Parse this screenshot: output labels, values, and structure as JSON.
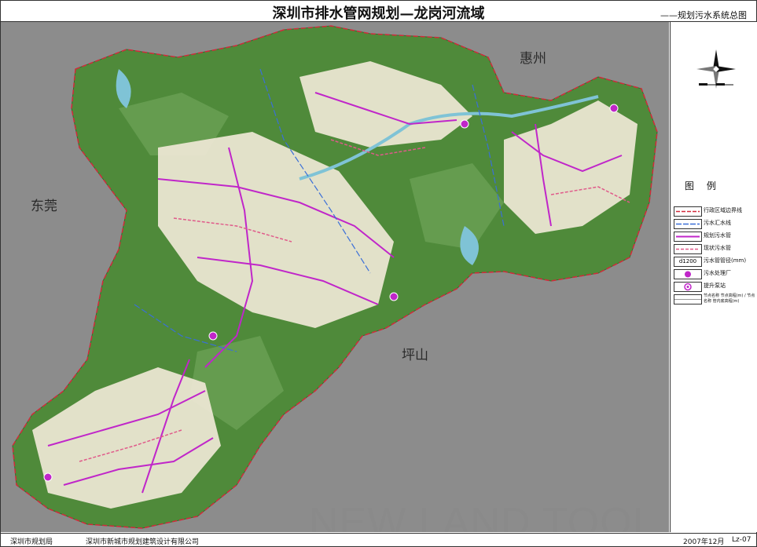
{
  "header": {
    "title": "深圳市排水管网规划—龙岗河流域",
    "subtitle": "——规划污水系统总图"
  },
  "regions": {
    "dongguan": "东莞",
    "huizhou": "惠州",
    "pingshan": "坪山"
  },
  "legend": {
    "title": "图 例",
    "items": [
      {
        "label": "行政区域边界线"
      },
      {
        "label": "污水汇水线"
      },
      {
        "label": "规划污水管"
      },
      {
        "label": "现状污水管"
      },
      {
        "label": "污水管管径(mm)",
        "symbol_text": "d1200"
      },
      {
        "label": "污水处理厂"
      },
      {
        "label": "提升泵站"
      },
      {
        "label": "节点名称 节点高程(m) / 节点名称 管内底高程(m)"
      }
    ]
  },
  "footer": {
    "left": "深圳市规划局",
    "middle": "深圳市新城市规划建筑设计有限公司",
    "date": "2007年12月",
    "code": "Lz-07"
  },
  "watermark": "NEW LAND TOOL",
  "colors": {
    "planned_pipe": "#c026c9",
    "existing_pipe": "#e05a8a",
    "boundary": "#d2293a",
    "catchment": "#3a6fd8",
    "forest": "#4f8a3a",
    "urban": "#efe8d6",
    "water": "#7fc3d6",
    "outside": "#8c8c8c"
  }
}
